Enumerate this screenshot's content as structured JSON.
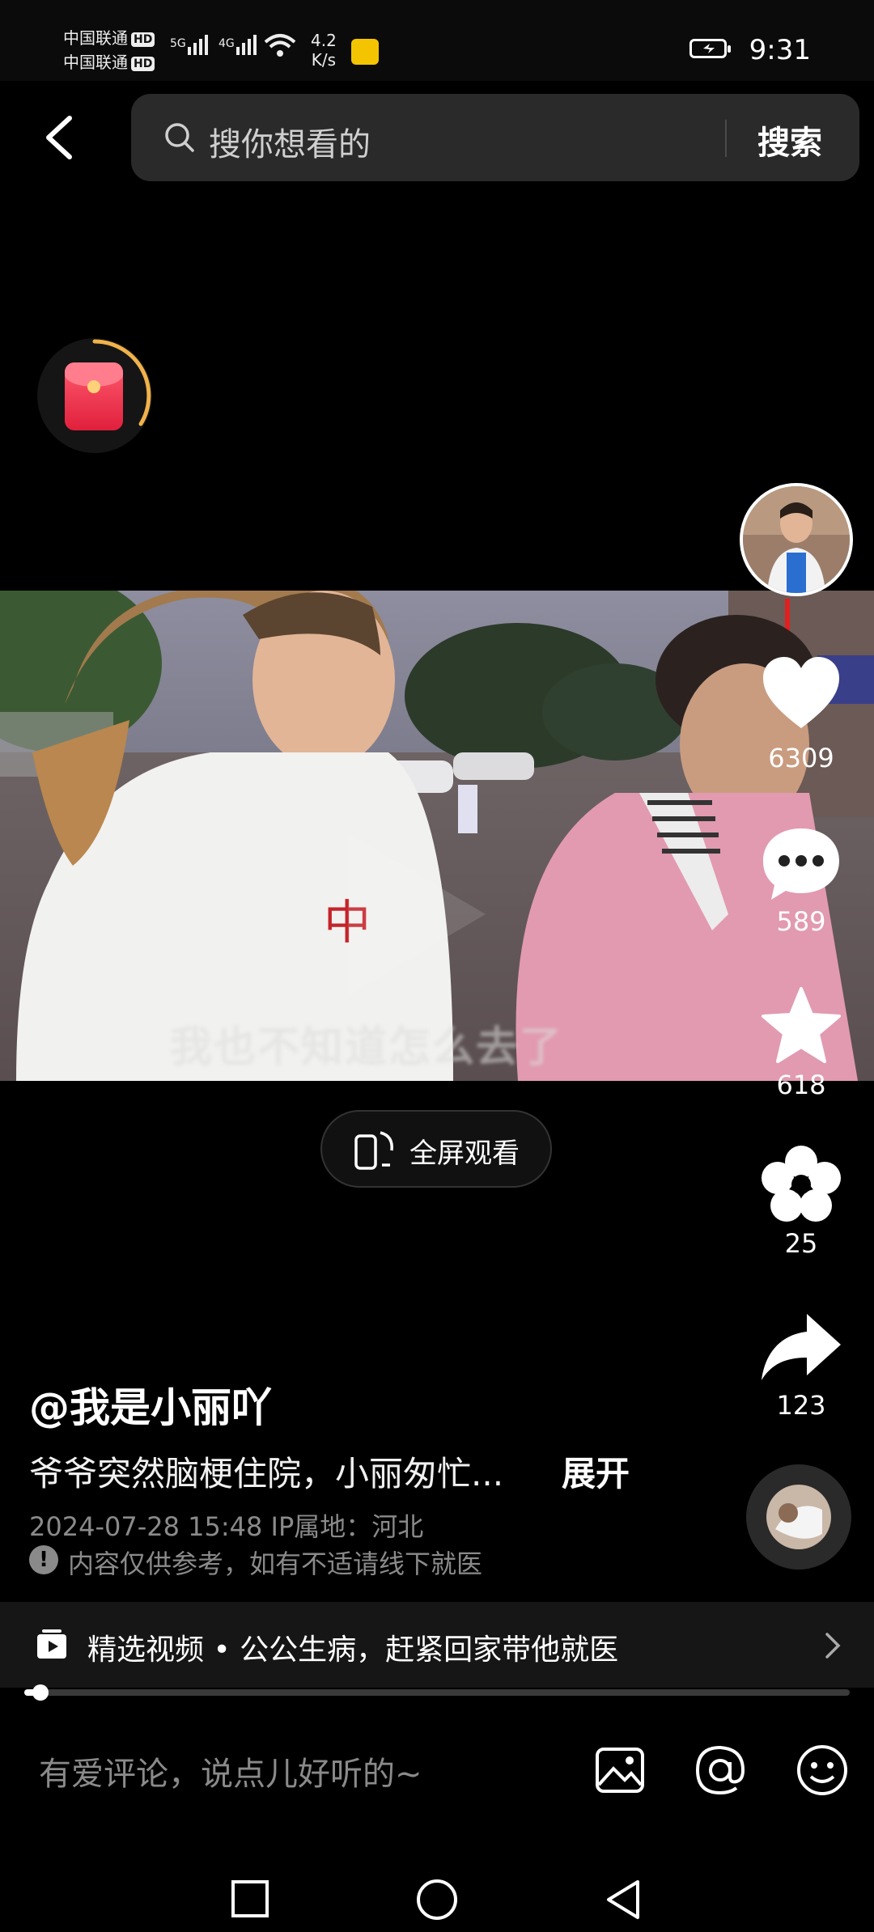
{
  "status_bar": {
    "carrier1": "中国联通",
    "carrier2": "中国联通",
    "hd": "HD",
    "net1": "5G",
    "net2": "4G",
    "speed_value": "4.2",
    "speed_unit": "K/s",
    "time": "9:31"
  },
  "search": {
    "placeholder": "搜你想看的",
    "button": "搜索"
  },
  "video": {
    "watermark": "我也不知道怎么去了"
  },
  "fullscreen_label": "全屏观看",
  "actions": {
    "like_count": "6309",
    "comment_count": "589",
    "favorite_count": "618",
    "flower_count": "25",
    "share_count": "123"
  },
  "post": {
    "author": "@我是小丽吖",
    "description": "爷爷突然脑梗住院，小丽匆忙...",
    "expand": "展开",
    "meta": "2024-07-28 15:48 IP属地：河北",
    "notice": "内容仅供参考，如有不适请线下就医"
  },
  "playlist": {
    "text": "精选视频 • 公公生病，赶紧回家带他就医"
  },
  "progress": 0.02,
  "comment": {
    "placeholder": "有爱评论，说点儿好听的~"
  },
  "colors": {
    "like": "#ffffff",
    "redpack": "#e8324e",
    "ring": "#f0b24a"
  }
}
